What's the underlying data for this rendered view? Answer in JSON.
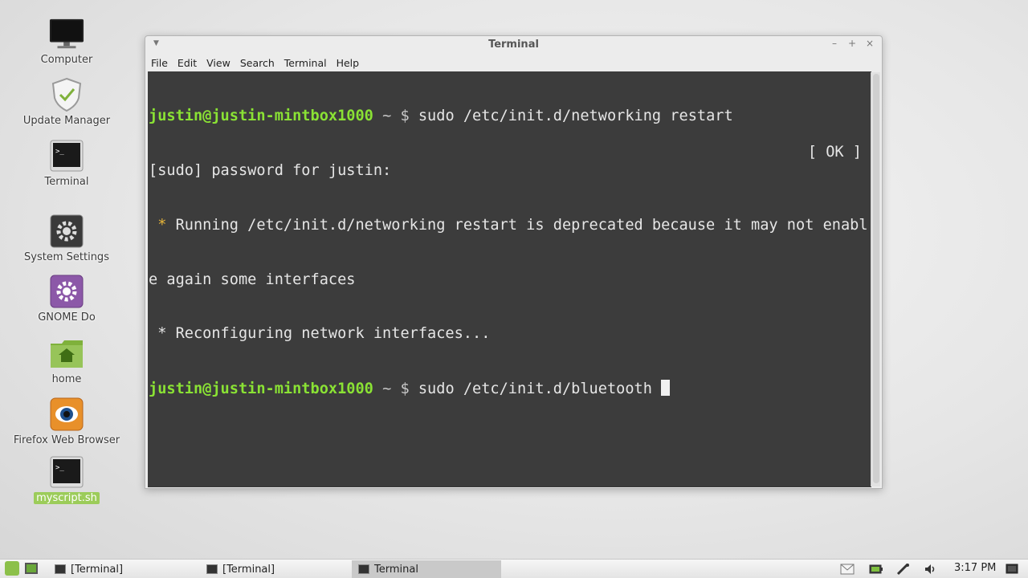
{
  "desktop": {
    "icons": [
      {
        "label": "Computer"
      },
      {
        "label": "Update Manager"
      },
      {
        "label": "Terminal"
      },
      {
        "label": "System Settings"
      },
      {
        "label": "GNOME Do"
      },
      {
        "label": "home"
      },
      {
        "label": "Firefox Web Browser"
      },
      {
        "label": "myscript.sh"
      }
    ]
  },
  "window": {
    "title": "Terminal",
    "menu": [
      "File",
      "Edit",
      "View",
      "Search",
      "Terminal",
      "Help"
    ],
    "controls": {
      "minimize": "–",
      "maximize": "+",
      "close": "×"
    }
  },
  "terminal": {
    "prompt_user": "justin@justin-mintbox1000",
    "prompt_sym": " ~ $ ",
    "cmd1": "sudo /etc/init.d/networking restart",
    "line2": "[sudo] password for justin:",
    "line3_star": " * ",
    "line3_text": "Running /etc/init.d/networking restart is deprecated because it may not enabl",
    "line4": "e again some interfaces",
    "line5": " * Reconfiguring network interfaces...",
    "line5_ok": "[ OK ]",
    "cmd2": "sudo /etc/init.d/bluetooth "
  },
  "taskbar": {
    "buttons": [
      "[Terminal]",
      "[Terminal]",
      "Terminal"
    ],
    "clock": "3:17 PM"
  },
  "colors": {
    "terminal_bg": "#3c3c3c",
    "prompt_green": "#8ae234",
    "star_yellow": "#e8b63a",
    "selected_label_bg": "#9ccc5a"
  }
}
